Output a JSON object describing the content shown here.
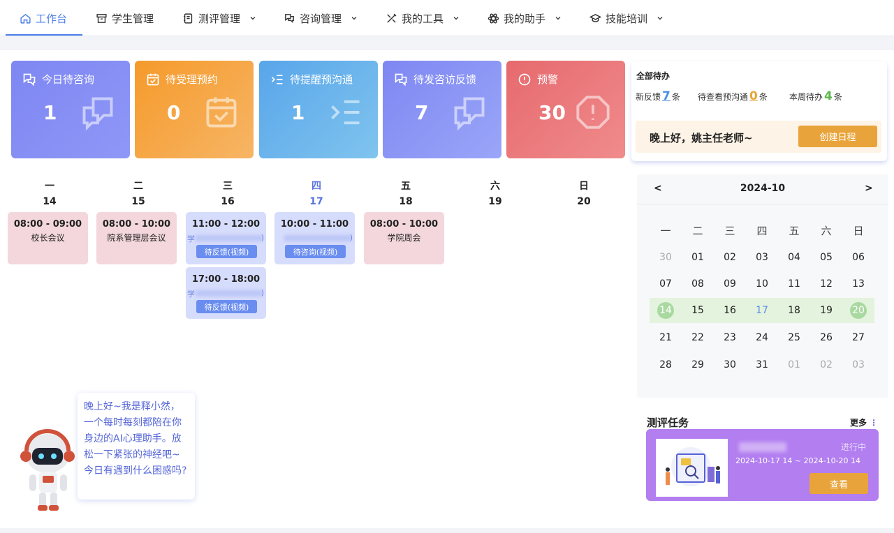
{
  "nav": [
    {
      "label": "工作台",
      "icon": "home-icon",
      "dropdown": false,
      "active": true
    },
    {
      "label": "学生管理",
      "icon": "archive-icon",
      "dropdown": false
    },
    {
      "label": "测评管理",
      "icon": "notebook-icon",
      "dropdown": true
    },
    {
      "label": "咨询管理",
      "icon": "chat-icon",
      "dropdown": true
    },
    {
      "label": "我的工具",
      "icon": "tools-icon",
      "dropdown": true
    },
    {
      "label": "我的助手",
      "icon": "atom-icon",
      "dropdown": true
    },
    {
      "label": "技能培训",
      "icon": "graduation-cap-icon",
      "dropdown": true
    }
  ],
  "cards": [
    {
      "label": "今日待咨询",
      "count": "1",
      "icon": "chat-icon",
      "color_from": "#7e87f2",
      "color_to": "#8f97f7"
    },
    {
      "label": "待受理预约",
      "count": "0",
      "icon": "calendar-check-icon",
      "color_from": "#f59a2b",
      "color_to": "#f7b565"
    },
    {
      "label": "待提醒预沟通",
      "count": "1",
      "icon": "list-indent-icon",
      "color_from": "#58a5ea",
      "color_to": "#80c4ee"
    },
    {
      "label": "待发咨访反馈",
      "count": "7",
      "icon": "chat-icon",
      "color_from": "#7e87f2",
      "color_to": "#9aa6f8"
    },
    {
      "label": "预警",
      "count": "30",
      "icon": "alert-octagon-icon",
      "color_from": "#e66a6e",
      "color_to": "#f08b8c"
    }
  ],
  "todo": {
    "title": "全部待办",
    "stats": [
      {
        "label": "新反馈",
        "value": "7",
        "unit": "条",
        "color": "#4a90e2"
      },
      {
        "label": "待查看预沟通",
        "value": "0",
        "unit": "条",
        "color": "#e8a43b"
      },
      {
        "label": "本周待办",
        "value": "4",
        "unit": "条",
        "color": "#5ab84a"
      }
    ],
    "greeting": "晚上好，姚主任老师~",
    "create_label": "创建日程"
  },
  "week": {
    "days": [
      {
        "name": "一",
        "date": "14"
      },
      {
        "name": "二",
        "date": "15"
      },
      {
        "name": "三",
        "date": "16"
      },
      {
        "name": "四",
        "date": "17",
        "today": true
      },
      {
        "name": "五",
        "date": "18"
      },
      {
        "name": "六",
        "date": "19"
      },
      {
        "name": "日",
        "date": "20"
      }
    ],
    "events": [
      {
        "time": "08:00 - 09:00",
        "title": "校长会议",
        "style": "pink"
      },
      {
        "time": "08:00 - 10:00",
        "title": "院系管理层会议",
        "style": "pink"
      },
      {
        "time": "11:00 - 12:00",
        "prefix": "学",
        "suffix": ")",
        "tag": "待反馈(视频)",
        "style": "blue"
      },
      {
        "time": "17:00 - 18:00",
        "prefix": "学",
        "suffix": ")",
        "tag": "待反馈(视频)",
        "style": "blue"
      },
      {
        "time": "10:00 - 11:00",
        "prefix": "",
        "suffix": ")",
        "tag": "待咨询(视频)",
        "style": "blue"
      },
      {
        "time": "08:00 - 10:00",
        "title": "学院周会",
        "style": "pink"
      }
    ]
  },
  "calendar": {
    "year_month": "2024-10",
    "prev": "<",
    "next": ">",
    "weekdays": [
      "一",
      "二",
      "三",
      "四",
      "五",
      "六",
      "日"
    ],
    "rows": [
      [
        "30",
        "01",
        "02",
        "03",
        "04",
        "05",
        "06"
      ],
      [
        "07",
        "08",
        "09",
        "10",
        "11",
        "12",
        "13"
      ],
      [
        "14",
        "15",
        "16",
        "17",
        "18",
        "19",
        "20"
      ],
      [
        "21",
        "22",
        "23",
        "24",
        "25",
        "26",
        "27"
      ],
      [
        "28",
        "29",
        "30",
        "31",
        "01",
        "02",
        "03"
      ]
    ]
  },
  "assistant": {
    "message": "晚上好~我是释小然，一个每时每刻都陪在你身边的AI心理助手。放松一下紧张的神经吧~今日有遇到什么困惑吗?"
  },
  "assessment": {
    "title": "测评任务",
    "more_label": "更多",
    "status": "进行中",
    "range": "2024-10-17 14 ~ 2024-10-20 14",
    "view_label": "查看"
  }
}
